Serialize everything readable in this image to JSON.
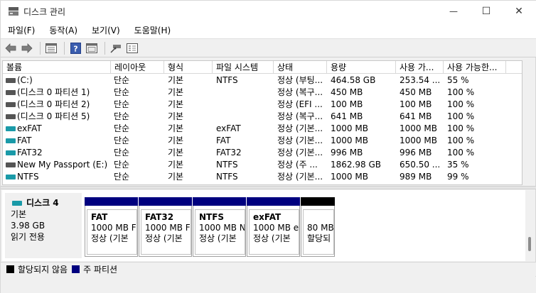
{
  "window": {
    "title": "디스크 관리",
    "minimize": "—",
    "maximize": "☐",
    "close": "✕"
  },
  "menu": [
    "파일(F)",
    "동작(A)",
    "보기(V)",
    "도움말(H)"
  ],
  "volume_table": {
    "headers": [
      "볼륨",
      "레이아웃",
      "형식",
      "파일 시스템",
      "상태",
      "용량",
      "사용 가...",
      "사용 가능한..."
    ],
    "rows": [
      {
        "volume": "(C:)",
        "layout": "단순",
        "type": "기본",
        "fs": "NTFS",
        "status": "정상 (부팅...",
        "capacity": "464.58 GB",
        "free": "253.54 ...",
        "pct": "55 %",
        "icon": "gray"
      },
      {
        "volume": "(디스크 0 파티션 1)",
        "layout": "단순",
        "type": "기본",
        "fs": "",
        "status": "정상 (복구...",
        "capacity": "450 MB",
        "free": "450 MB",
        "pct": "100 %",
        "icon": "gray"
      },
      {
        "volume": "(디스크 0 파티션 2)",
        "layout": "단순",
        "type": "기본",
        "fs": "",
        "status": "정상 (EFI ...",
        "capacity": "100 MB",
        "free": "100 MB",
        "pct": "100 %",
        "icon": "gray"
      },
      {
        "volume": "(디스크 0 파티션 5)",
        "layout": "단순",
        "type": "기본",
        "fs": "",
        "status": "정상 (복구...",
        "capacity": "641 MB",
        "free": "641 MB",
        "pct": "100 %",
        "icon": "gray"
      },
      {
        "volume": "exFAT",
        "layout": "단순",
        "type": "기본",
        "fs": "exFAT",
        "status": "정상 (기본...",
        "capacity": "1000 MB",
        "free": "1000 MB",
        "pct": "100 %",
        "icon": "teal"
      },
      {
        "volume": "FAT",
        "layout": "단순",
        "type": "기본",
        "fs": "FAT",
        "status": "정상 (기본...",
        "capacity": "1000 MB",
        "free": "1000 MB",
        "pct": "100 %",
        "icon": "teal"
      },
      {
        "volume": "FAT32",
        "layout": "단순",
        "type": "기본",
        "fs": "FAT32",
        "status": "정상 (기본...",
        "capacity": "996 MB",
        "free": "996 MB",
        "pct": "100 %",
        "icon": "teal"
      },
      {
        "volume": "New My Passport (E:)",
        "layout": "단순",
        "type": "기본",
        "fs": "NTFS",
        "status": "정상 (주 ...",
        "capacity": "1862.98 GB",
        "free": "650.50 ...",
        "pct": "35 %",
        "icon": "gray"
      },
      {
        "volume": "NTFS",
        "layout": "단순",
        "type": "기본",
        "fs": "NTFS",
        "status": "정상 (기본...",
        "capacity": "1000 MB",
        "free": "989 MB",
        "pct": "99 %",
        "icon": "teal"
      }
    ]
  },
  "disk": {
    "name": "디스크 4",
    "type": "기본",
    "size": "3.98 GB",
    "state": "읽기 전용",
    "partitions": [
      {
        "name": "FAT",
        "size": "1000 MB F",
        "status": "정상 (기본",
        "color": "#00007f"
      },
      {
        "name": "FAT32",
        "size": "1000 MB F",
        "status": "정상 (기본",
        "color": "#00007f"
      },
      {
        "name": "NTFS",
        "size": "1000 MB N",
        "status": "정상 (기본",
        "color": "#00007f"
      },
      {
        "name": "exFAT",
        "size": "1000 MB e",
        "status": "정상 (기본",
        "color": "#00007f"
      },
      {
        "name": "",
        "size": "80 MB",
        "status": "할당되",
        "color": "#000000"
      }
    ]
  },
  "legend": [
    {
      "label": "할당되지 않음",
      "color": "#000000"
    },
    {
      "label": "주 파티션",
      "color": "#00007f"
    }
  ],
  "icons": [
    "disk-management-icon",
    "back-icon",
    "forward-icon",
    "properties-icon",
    "help-icon",
    "console-icon",
    "connect-icon",
    "settings-icon"
  ]
}
